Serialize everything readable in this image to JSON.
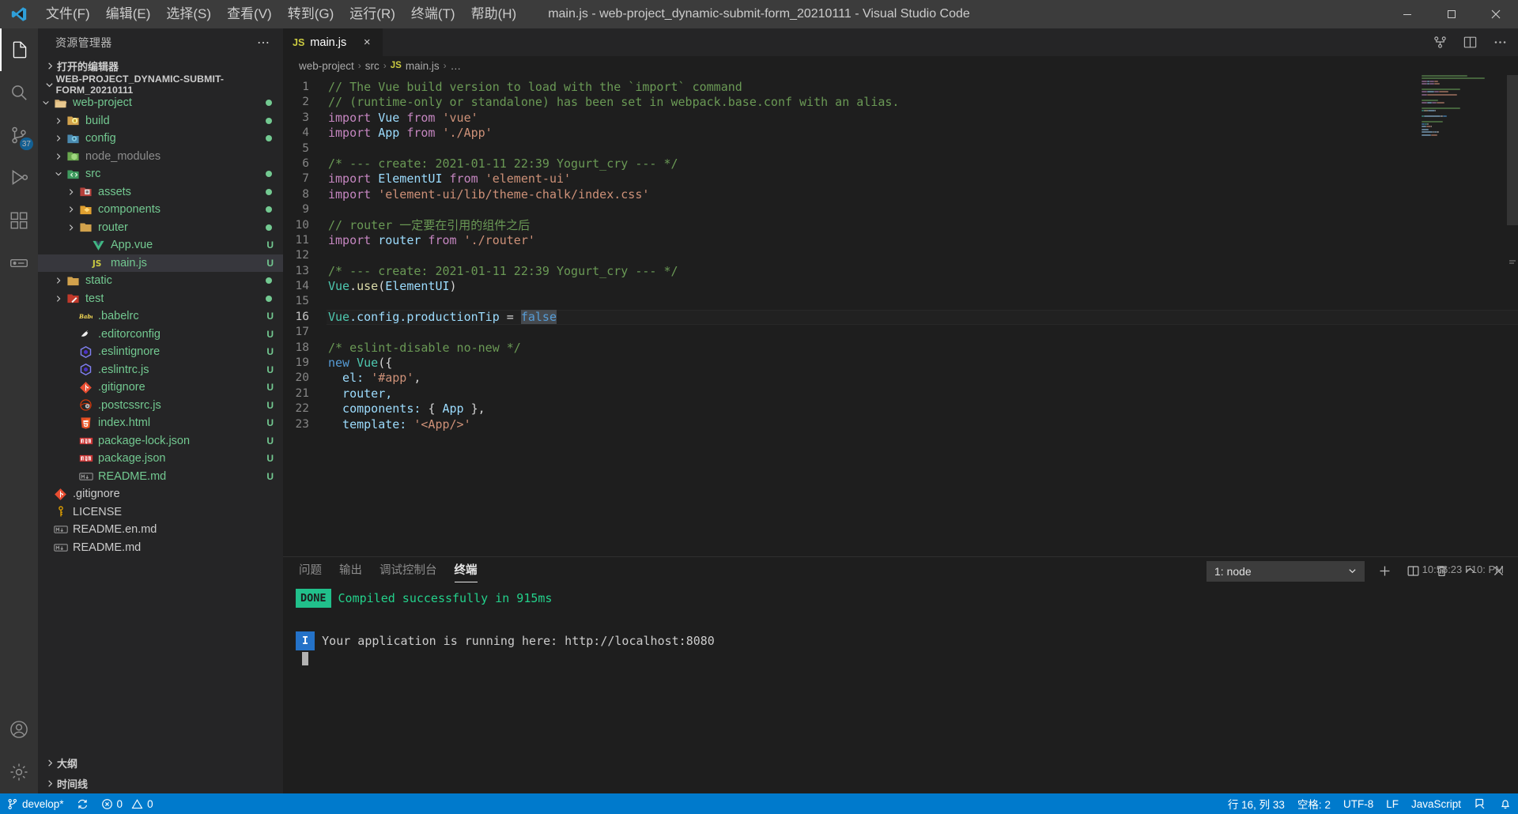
{
  "titlebar": {
    "title": "main.js - web-project_dynamic-submit-form_20210111 - Visual Studio Code",
    "menus": [
      {
        "label": "文件(F)",
        "name": "menu-file"
      },
      {
        "label": "编辑(E)",
        "name": "menu-edit"
      },
      {
        "label": "选择(S)",
        "name": "menu-selection"
      },
      {
        "label": "查看(V)",
        "name": "menu-view"
      },
      {
        "label": "转到(G)",
        "name": "menu-go"
      },
      {
        "label": "运行(R)",
        "name": "menu-run"
      },
      {
        "label": "终端(T)",
        "name": "menu-terminal"
      },
      {
        "label": "帮助(H)",
        "name": "menu-help"
      }
    ]
  },
  "activitybar": {
    "scm_badge": "37",
    "items": [
      "explorer",
      "search",
      "source-control",
      "run-and-debug",
      "extensions",
      "remote",
      "account",
      "settings"
    ]
  },
  "sidebar": {
    "header": "资源管理器",
    "open_editors_label": "打开的编辑器",
    "workspace_label": "WEB-PROJECT_DYNAMIC-SUBMIT-FORM_20210111",
    "bottom_sections": [
      {
        "label": "大纲",
        "name": "outline-section"
      },
      {
        "label": "时间线",
        "name": "timeline-section"
      }
    ],
    "tree": [
      {
        "label": "web-project",
        "indent": 1,
        "type": "folder",
        "icon": "folder-open",
        "state": "open",
        "color": "mod",
        "deco": "dot"
      },
      {
        "label": "build",
        "indent": 2,
        "type": "folder",
        "icon": "folder-build",
        "state": "closed",
        "color": "mod",
        "deco": "dot"
      },
      {
        "label": "config",
        "indent": 2,
        "type": "folder",
        "icon": "folder-config",
        "state": "closed",
        "color": "mod",
        "deco": "dot"
      },
      {
        "label": "node_modules",
        "indent": 2,
        "type": "folder",
        "icon": "folder-node",
        "state": "closed",
        "color": "ign",
        "deco": ""
      },
      {
        "label": "src",
        "indent": 2,
        "type": "folder",
        "icon": "folder-src",
        "state": "open",
        "color": "mod",
        "deco": "dot"
      },
      {
        "label": "assets",
        "indent": 3,
        "type": "folder",
        "icon": "folder-assets",
        "state": "closed",
        "color": "mod",
        "deco": "dot"
      },
      {
        "label": "components",
        "indent": 3,
        "type": "folder",
        "icon": "folder-components",
        "state": "closed",
        "color": "mod",
        "deco": "dot"
      },
      {
        "label": "router",
        "indent": 3,
        "type": "folder",
        "icon": "folder-router",
        "state": "closed",
        "color": "mod",
        "deco": "dot"
      },
      {
        "label": "App.vue",
        "indent": 4,
        "type": "file",
        "icon": "vue",
        "color": "mod",
        "deco": "U"
      },
      {
        "label": "main.js",
        "indent": 4,
        "type": "file",
        "icon": "js",
        "color": "mod",
        "deco": "U",
        "selected": true
      },
      {
        "label": "static",
        "indent": 2,
        "type": "folder",
        "icon": "folder-static",
        "state": "closed",
        "color": "mod",
        "deco": "dot"
      },
      {
        "label": "test",
        "indent": 2,
        "type": "folder",
        "icon": "folder-test",
        "state": "closed",
        "color": "mod",
        "deco": "dot"
      },
      {
        "label": ".babelrc",
        "indent": 3,
        "type": "file",
        "icon": "babel",
        "color": "mod",
        "deco": "U"
      },
      {
        "label": ".editorconfig",
        "indent": 3,
        "type": "file",
        "icon": "editorconfig",
        "color": "mod",
        "deco": "U"
      },
      {
        "label": ".eslintignore",
        "indent": 3,
        "type": "file",
        "icon": "eslint",
        "color": "mod",
        "deco": "U"
      },
      {
        "label": ".eslintrc.js",
        "indent": 3,
        "type": "file",
        "icon": "eslint",
        "color": "mod",
        "deco": "U"
      },
      {
        "label": ".gitignore",
        "indent": 3,
        "type": "file",
        "icon": "git",
        "color": "mod",
        "deco": "U"
      },
      {
        "label": ".postcssrc.js",
        "indent": 3,
        "type": "file",
        "icon": "postcss",
        "color": "mod",
        "deco": "U"
      },
      {
        "label": "index.html",
        "indent": 3,
        "type": "file",
        "icon": "html",
        "color": "mod",
        "deco": "U"
      },
      {
        "label": "package-lock.json",
        "indent": 3,
        "type": "file",
        "icon": "npm",
        "color": "mod",
        "deco": "U"
      },
      {
        "label": "package.json",
        "indent": 3,
        "type": "file",
        "icon": "npm",
        "color": "mod",
        "deco": "U"
      },
      {
        "label": "README.md",
        "indent": 3,
        "type": "file",
        "icon": "markdown",
        "color": "mod",
        "deco": "U"
      },
      {
        "label": ".gitignore",
        "indent": 1,
        "type": "file",
        "icon": "git",
        "color": "",
        "deco": ""
      },
      {
        "label": "LICENSE",
        "indent": 1,
        "type": "file",
        "icon": "license",
        "color": "",
        "deco": ""
      },
      {
        "label": "README.en.md",
        "indent": 1,
        "type": "file",
        "icon": "markdown",
        "color": "",
        "deco": ""
      },
      {
        "label": "README.md",
        "indent": 1,
        "type": "file",
        "icon": "markdown",
        "color": "",
        "deco": ""
      }
    ]
  },
  "editor": {
    "tab": {
      "label": "main.js",
      "icon": "js",
      "close": "×"
    },
    "breadcrumbs": [
      "web-project",
      "src",
      "main.js",
      "…"
    ],
    "lines": [
      {
        "n": 1,
        "segs": [
          {
            "t": "// The Vue build version to load with the `import` command",
            "c": "c-com"
          }
        ]
      },
      {
        "n": 2,
        "segs": [
          {
            "t": "// (runtime-only or standalone) has been set in webpack.base.conf with an alias.",
            "c": "c-com"
          }
        ]
      },
      {
        "n": 3,
        "segs": [
          {
            "t": "import ",
            "c": "c-kw"
          },
          {
            "t": "Vue",
            "c": "c-id"
          },
          {
            "t": " from ",
            "c": "c-kw"
          },
          {
            "t": "'vue'",
            "c": "c-str"
          }
        ]
      },
      {
        "n": 4,
        "segs": [
          {
            "t": "import ",
            "c": "c-kw"
          },
          {
            "t": "App",
            "c": "c-id"
          },
          {
            "t": " from ",
            "c": "c-kw"
          },
          {
            "t": "'./App'",
            "c": "c-str"
          }
        ]
      },
      {
        "n": 5,
        "segs": []
      },
      {
        "n": 6,
        "segs": [
          {
            "t": "/* --- create: 2021-01-11 22:39 Yogurt_cry --- */",
            "c": "c-com"
          }
        ]
      },
      {
        "n": 7,
        "segs": [
          {
            "t": "import ",
            "c": "c-kw"
          },
          {
            "t": "ElementUI",
            "c": "c-id"
          },
          {
            "t": " from ",
            "c": "c-kw"
          },
          {
            "t": "'element-ui'",
            "c": "c-str"
          }
        ]
      },
      {
        "n": 8,
        "segs": [
          {
            "t": "import ",
            "c": "c-kw"
          },
          {
            "t": "'element-ui/lib/theme-chalk/index.css'",
            "c": "c-str"
          }
        ]
      },
      {
        "n": 9,
        "segs": []
      },
      {
        "n": 10,
        "segs": [
          {
            "t": "// router 一定要在引用的组件之后",
            "c": "c-com"
          }
        ]
      },
      {
        "n": 11,
        "segs": [
          {
            "t": "import ",
            "c": "c-kw"
          },
          {
            "t": "router",
            "c": "c-id"
          },
          {
            "t": " from ",
            "c": "c-kw"
          },
          {
            "t": "'./router'",
            "c": "c-str"
          }
        ]
      },
      {
        "n": 12,
        "segs": []
      },
      {
        "n": 13,
        "segs": [
          {
            "t": "/* --- create: 2021-01-11 22:39 Yogurt_cry --- */",
            "c": "c-com"
          }
        ]
      },
      {
        "n": 14,
        "segs": [
          {
            "t": "Vue",
            "c": "c-var"
          },
          {
            "t": ".",
            "c": "c-pl"
          },
          {
            "t": "use",
            "c": "c-fn"
          },
          {
            "t": "(",
            "c": "c-pl"
          },
          {
            "t": "ElementUI",
            "c": "c-id"
          },
          {
            "t": ")",
            "c": "c-pl"
          }
        ]
      },
      {
        "n": 15,
        "segs": []
      },
      {
        "n": 16,
        "current": true,
        "segs": [
          {
            "t": "Vue",
            "c": "c-var"
          },
          {
            "t": ".config.productionTip",
            "c": "c-id"
          },
          {
            "t": " = ",
            "c": "c-pl"
          },
          {
            "t": "false",
            "c": "c-kw2 selgray"
          }
        ]
      },
      {
        "n": 17,
        "segs": []
      },
      {
        "n": 18,
        "segs": [
          {
            "t": "/* eslint-disable no-new */",
            "c": "c-com"
          }
        ]
      },
      {
        "n": 19,
        "segs": [
          {
            "t": "new ",
            "c": "c-kw2"
          },
          {
            "t": "Vue",
            "c": "c-var"
          },
          {
            "t": "({",
            "c": "c-pl"
          }
        ]
      },
      {
        "n": 20,
        "segs": [
          {
            "t": "  el: ",
            "c": "c-id"
          },
          {
            "t": "'#app'",
            "c": "c-str"
          },
          {
            "t": ",",
            "c": "c-pl"
          }
        ]
      },
      {
        "n": 21,
        "segs": [
          {
            "t": "  router,",
            "c": "c-id"
          }
        ]
      },
      {
        "n": 22,
        "segs": [
          {
            "t": "  components: ",
            "c": "c-id"
          },
          {
            "t": "{ ",
            "c": "c-pl"
          },
          {
            "t": "App",
            "c": "c-id"
          },
          {
            "t": " },",
            "c": "c-pl"
          }
        ]
      },
      {
        "n": 23,
        "segs": [
          {
            "t": "  template: ",
            "c": "c-id"
          },
          {
            "t": "'<App/>'",
            "c": "c-str"
          }
        ]
      }
    ]
  },
  "panel": {
    "tabs": [
      {
        "label": "问题",
        "name": "panel-tab-problems",
        "active": false
      },
      {
        "label": "输出",
        "name": "panel-tab-output",
        "active": false
      },
      {
        "label": "调试控制台",
        "name": "panel-tab-debug-console",
        "active": false
      },
      {
        "label": "终端",
        "name": "panel-tab-terminal",
        "active": true
      }
    ],
    "terminal_selected": "1: node",
    "timestamp": "10:56:23  F10:  PM",
    "lines": [
      {
        "tag": "DONE",
        "tag_type": "done",
        "text": "Compiled successfully in 915ms"
      },
      {
        "tag": "I",
        "tag_type": "info",
        "text": "Your application is running here: http://localhost:8080"
      }
    ]
  },
  "statusbar": {
    "branch": "develop*",
    "errors": "0",
    "warnings": "0",
    "position": "行 16, 列 33",
    "spaces": "空格: 2",
    "encoding": "UTF-8",
    "eol": "LF",
    "language": "JavaScript"
  }
}
